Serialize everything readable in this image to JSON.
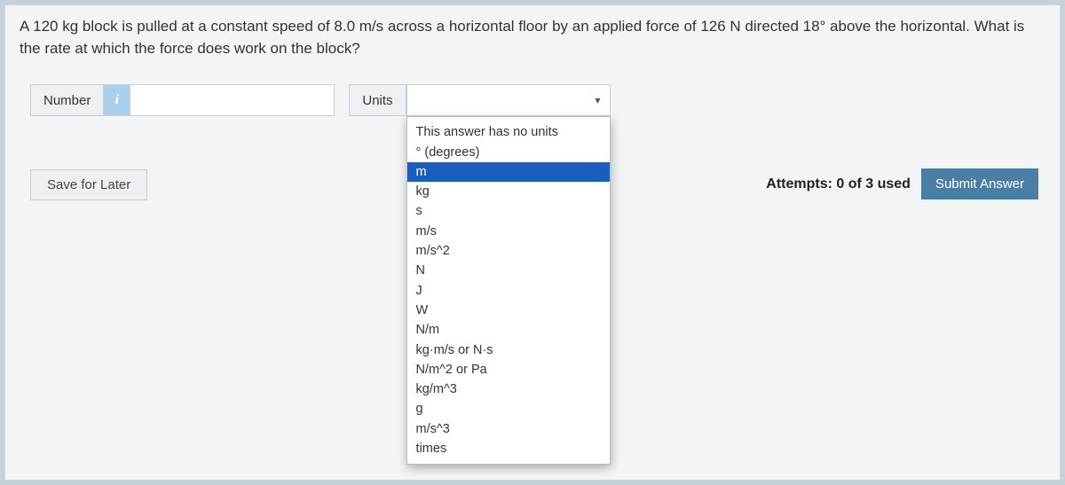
{
  "prompt": "A 120 kg block is pulled at a constant speed of 8.0 m/s across a horizontal floor by an applied force of 126 N directed 18° above the horizontal. What is the rate at which the force does work on the block?",
  "input": {
    "number_label": "Number",
    "info_glyph": "i",
    "number_value": "",
    "units_label": "Units",
    "units_selected": ""
  },
  "dropdown": {
    "options": [
      "This answer has no units",
      "° (degrees)",
      "m",
      "kg",
      "s",
      "m/s",
      "m/s^2",
      "N",
      "J",
      "W",
      "N/m",
      "kg·m/s or N·s",
      "N/m^2 or Pa",
      "kg/m^3",
      "g",
      "m/s^3",
      "times"
    ],
    "highlighted_index": 2
  },
  "footer": {
    "save_label": "Save for Later",
    "attempts_text": "Attempts: 0 of 3 used",
    "submit_label": "Submit Answer"
  }
}
